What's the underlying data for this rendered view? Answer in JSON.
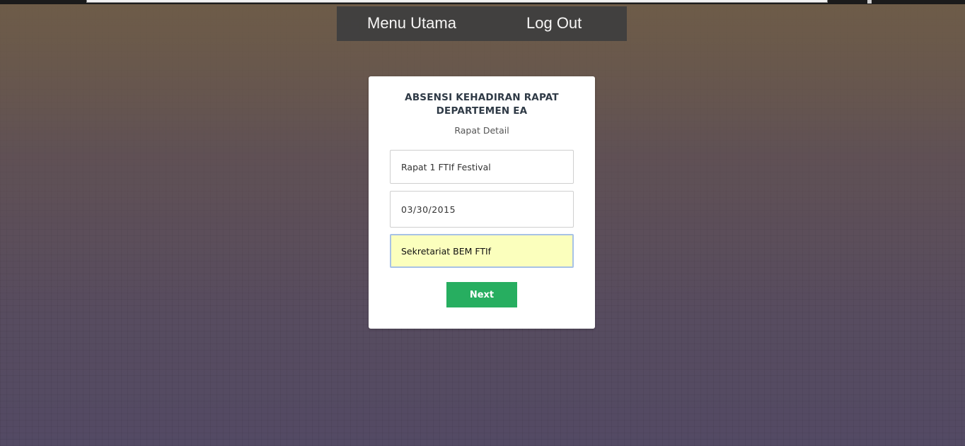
{
  "nav": {
    "menu_utama": "Menu Utama",
    "log_out": "Log Out"
  },
  "card": {
    "title": "ABSENSI KEHADIRAN RAPAT DEPARTEMEN EA",
    "subtitle": "Rapat Detail"
  },
  "form": {
    "meeting_name": "Rapat 1 FTIf Festival",
    "meeting_date": "03/30/2015",
    "meeting_place": "Sekretariat BEM FTIf",
    "next_label": "Next"
  },
  "colors": {
    "nav_bg": "#3f3f3f",
    "card_bg": "#ffffff",
    "title_color": "#2f3a46",
    "button_green": "#27ae60",
    "focused_field_bg": "#fbffbd"
  }
}
